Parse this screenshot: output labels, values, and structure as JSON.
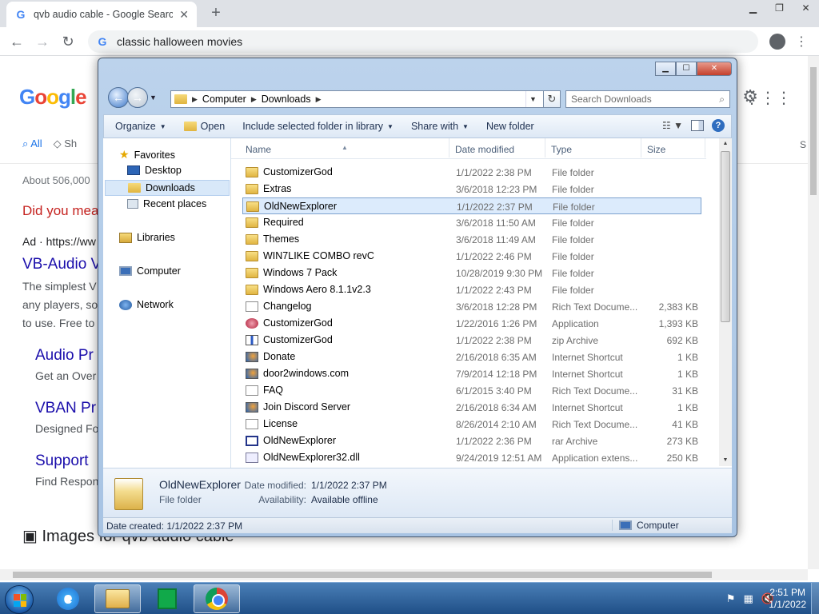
{
  "chrome": {
    "tab_title": "qvb audio cable - Google Search",
    "omnibox_text": "classic halloween movies"
  },
  "google": {
    "tab_all": "All",
    "tab_partial": "Sh",
    "right_partial": "S",
    "results_count": "About 506,000",
    "did_you_mean": "Did you mea",
    "ad_line": "Ad · https://ww",
    "ad_title": "VB-Audio V",
    "ad_desc1": "The simplest V",
    "ad_desc2": "any players, so",
    "ad_desc3": "to use. Free to",
    "link1_title": "Audio Pr",
    "link1_desc": "Get an Over",
    "link2_title": "VBAN Pr",
    "link2_desc": "Designed Fo",
    "link3_title": "Support",
    "link3_desc": "Find Respon",
    "images_heading": "Images for qvb audio cable"
  },
  "explorer": {
    "breadcrumb": [
      "Computer",
      "Downloads"
    ],
    "search_placeholder": "Search Downloads",
    "commands": {
      "organize": "Organize",
      "open": "Open",
      "include": "Include selected folder in library",
      "share": "Share with",
      "new_folder": "New folder"
    },
    "nav": {
      "favorites": "Favorites",
      "desktop": "Desktop",
      "downloads": "Downloads",
      "recent": "Recent places",
      "libraries": "Libraries",
      "computer": "Computer",
      "network": "Network"
    },
    "columns": {
      "name": "Name",
      "date": "Date modified",
      "type": "Type",
      "size": "Size"
    },
    "files": [
      {
        "name": "CustomizerGod",
        "date": "1/1/2022 2:38 PM",
        "type": "File folder",
        "size": "",
        "icon": "folder"
      },
      {
        "name": "Extras",
        "date": "3/6/2018 12:23 PM",
        "type": "File folder",
        "size": "",
        "icon": "folder"
      },
      {
        "name": "OldNewExplorer",
        "date": "1/1/2022 2:37 PM",
        "type": "File folder",
        "size": "",
        "icon": "folder",
        "selected": true
      },
      {
        "name": "Required",
        "date": "3/6/2018 11:50 AM",
        "type": "File folder",
        "size": "",
        "icon": "folder"
      },
      {
        "name": "Themes",
        "date": "3/6/2018 11:49 AM",
        "type": "File folder",
        "size": "",
        "icon": "folder"
      },
      {
        "name": "WIN7LIKE COMBO revC",
        "date": "1/1/2022 2:46 PM",
        "type": "File folder",
        "size": "",
        "icon": "folder"
      },
      {
        "name": "Windows 7 Pack",
        "date": "10/28/2019 9:30 PM",
        "type": "File folder",
        "size": "",
        "icon": "folder"
      },
      {
        "name": "Windows Aero 8.1.1v2.3",
        "date": "1/1/2022 2:43 PM",
        "type": "File folder",
        "size": "",
        "icon": "folder"
      },
      {
        "name": "Changelog",
        "date": "3/6/2018 12:28 PM",
        "type": "Rich Text Docume...",
        "size": "2,383 KB",
        "icon": "doc"
      },
      {
        "name": "CustomizerGod",
        "date": "1/22/2016 1:26 PM",
        "type": "Application",
        "size": "1,393 KB",
        "icon": "app"
      },
      {
        "name": "CustomizerGod",
        "date": "1/1/2022 2:38 PM",
        "type": "zip Archive",
        "size": "692 KB",
        "icon": "zip"
      },
      {
        "name": "Donate",
        "date": "2/16/2018 6:35 AM",
        "type": "Internet Shortcut",
        "size": "1 KB",
        "icon": "url"
      },
      {
        "name": "door2windows.com",
        "date": "7/9/2014 12:18 PM",
        "type": "Internet Shortcut",
        "size": "1 KB",
        "icon": "url"
      },
      {
        "name": "FAQ",
        "date": "6/1/2015 3:40 PM",
        "type": "Rich Text Docume...",
        "size": "31 KB",
        "icon": "doc"
      },
      {
        "name": "Join Discord Server",
        "date": "2/16/2018 6:34 AM",
        "type": "Internet Shortcut",
        "size": "1 KB",
        "icon": "url"
      },
      {
        "name": "License",
        "date": "8/26/2014 2:10 AM",
        "type": "Rich Text Docume...",
        "size": "41 KB",
        "icon": "doc"
      },
      {
        "name": "OldNewExplorer",
        "date": "1/1/2022 2:36 PM",
        "type": "rar Archive",
        "size": "273 KB",
        "icon": "rar"
      },
      {
        "name": "OldNewExplorer32.dll",
        "date": "9/24/2019 12:51 AM",
        "type": "Application extens...",
        "size": "250 KB",
        "icon": "dll"
      }
    ],
    "details": {
      "name": "OldNewExplorer",
      "type": "File folder",
      "date_label": "Date modified:",
      "date_value": "1/1/2022 2:37 PM",
      "avail_label": "Availability:",
      "avail_value": "Available offline"
    },
    "status": {
      "left": "Date created: 1/1/2022 2:37 PM",
      "right": "Computer"
    }
  },
  "taskbar": {
    "time": "2:51 PM",
    "date": "1/1/2022"
  }
}
